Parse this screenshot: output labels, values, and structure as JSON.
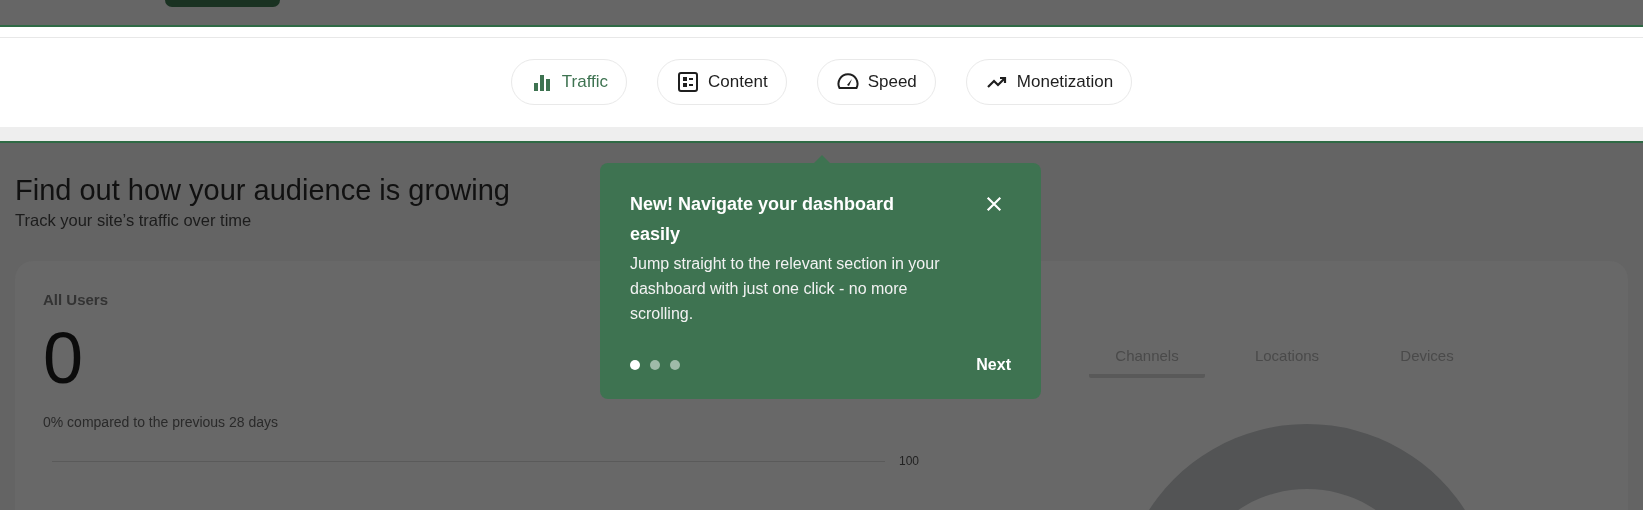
{
  "nav_tabs": [
    {
      "label": "Traffic",
      "selected": true
    },
    {
      "label": "Content",
      "selected": false
    },
    {
      "label": "Speed",
      "selected": false
    },
    {
      "label": "Monetization",
      "selected": false
    }
  ],
  "section": {
    "title": "Find out how your audience is growing",
    "subtitle": "Track your site’s traffic over time"
  },
  "card": {
    "label": "All Users",
    "value": "0",
    "comparison": "0% compared to the previous 28 days",
    "axis_label": "100",
    "breakdown_tabs": [
      {
        "label": "Channels",
        "selected": true
      },
      {
        "label": "Locations",
        "selected": false
      },
      {
        "label": "Devices",
        "selected": false
      }
    ]
  },
  "tooltip": {
    "title": "New! Navigate your dashboard easily",
    "body": "Jump straight to the relevant section in your dashboard with just one click - no more scrolling.",
    "steps": [
      {
        "selected": true
      },
      {
        "selected": false
      },
      {
        "selected": false
      }
    ],
    "next": "Next"
  }
}
